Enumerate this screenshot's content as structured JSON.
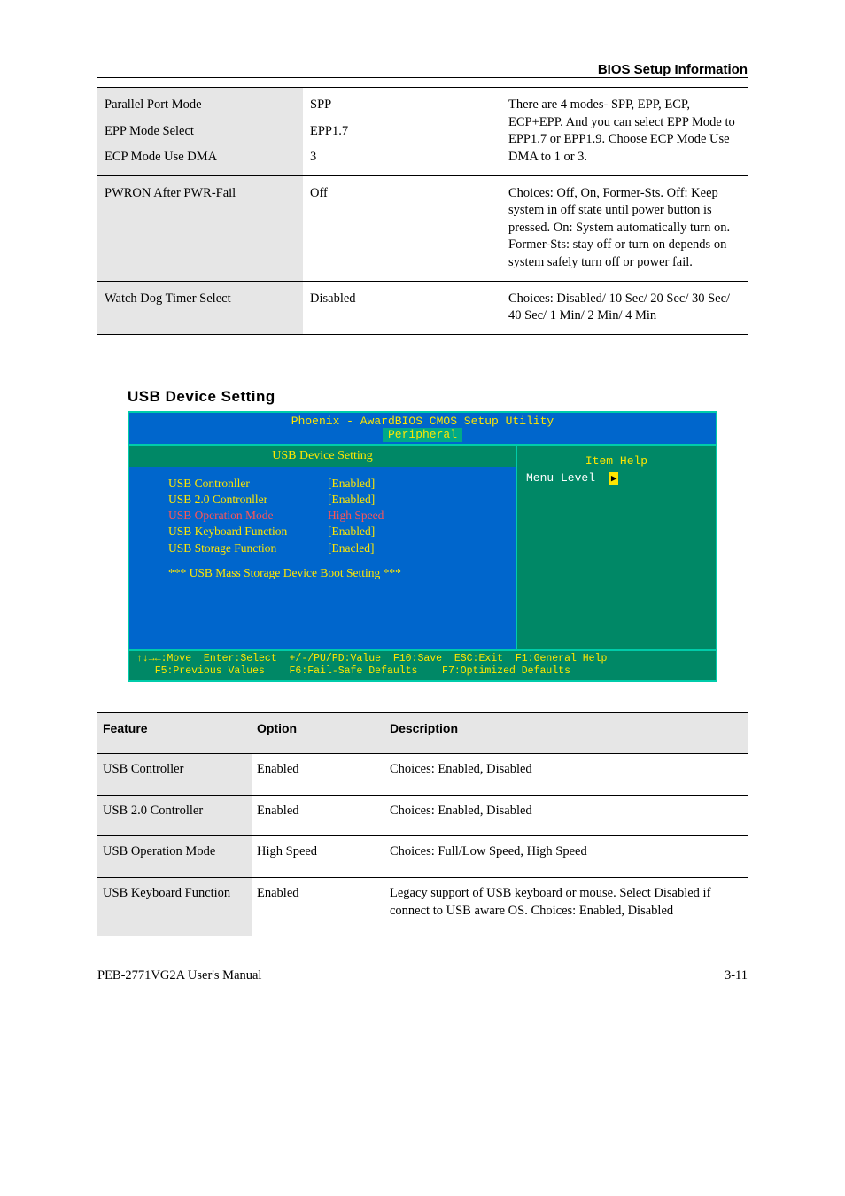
{
  "page_header_right": "BIOS Setup Information",
  "table1": {
    "rows": [
      {
        "c1_stack": [
          "Parallel Port Mode",
          "EPP Mode Select",
          "ECP Mode Use DMA"
        ],
        "c2_stack": [
          "SPP",
          "EPP1.7",
          "3"
        ],
        "c3": "There are 4 modes- SPP, EPP, ECP, ECP+EPP. And you can select EPP Mode to EPP1.7 or EPP1.9. Choose ECP Mode Use DMA to 1 or 3."
      },
      {
        "c1": "PWRON After PWR-Fail",
        "c2": "Off",
        "c3": "Choices: Off, On, Former-Sts. Off: Keep system in off state until power button is pressed. On: System automatically turn on. Former-Sts: stay off or turn on depends on system safely turn off or power fail."
      },
      {
        "c1": "Watch Dog Timer Select",
        "c2": "Disabled",
        "c3": "Choices: Disabled/ 10 Sec/ 20 Sec/ 30 Sec/ 40 Sec/ 1 Min/ 2 Min/ 4 Min"
      }
    ]
  },
  "bios": {
    "section_title": "USB Device Setting",
    "title_line1": "Phoenix - AwardBIOS CMOS Setup Utility",
    "title_line2": "Peripheral",
    "left_head": "USB Device Setting",
    "right_head": "Item Help",
    "menu_level": "Menu Level",
    "settings": [
      {
        "name": "USB Contronller",
        "val": "[Enabled]",
        "red": false
      },
      {
        "name": "USB 2.0 Contronller",
        "val": "[Enabled]",
        "red": false
      },
      {
        "name": "USB Operation Mode",
        "val": "High Speed",
        "red": true
      },
      {
        "name": "USB Keyboard Function",
        "val": "[Enabled]",
        "red": false
      },
      {
        "name": "USB Storage Function",
        "val": "[Enacled]",
        "red": false
      }
    ],
    "note": "*** USB Mass Storage Device Boot Setting ***",
    "footer_line1": "↑↓→←:Move  Enter:Select  +/-/PU/PD:Value  F10:Save  ESC:Exit  F1:General Help",
    "footer_line2": "   F5:Previous Values    F6:Fail-Safe Defaults    F7:Optimized Defaults"
  },
  "table2": {
    "header": [
      "Feature",
      "Option",
      "Description"
    ],
    "rows": [
      {
        "b1": "USB Controller",
        "b2": "Enabled",
        "b3": "Choices: Enabled, Disabled"
      },
      {
        "b1": "USB 2.0 Controller",
        "b2": "Enabled",
        "b3": "Choices: Enabled, Disabled"
      },
      {
        "b1": "USB Operation Mode",
        "b2": "High Speed",
        "b3": "Choices: Full/Low Speed, High Speed"
      },
      {
        "b1": "USB Keyboard Function",
        "b2": "Enabled",
        "b3": "Legacy support of USB keyboard or mouse. Select Disabled if connect to USB aware OS. Choices: Enabled, Disabled"
      }
    ]
  },
  "footer": {
    "left": "PEB-2771VG2A User's Manual",
    "right": "3-11"
  }
}
